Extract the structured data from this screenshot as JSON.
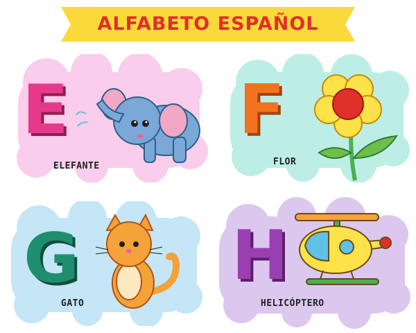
{
  "title": "ALFABETO ESPAÑOL",
  "colors": {
    "banner": "#fbd93a",
    "title_text": "#e0302a",
    "card_e": "#f9cdeb",
    "card_f": "#bdeee6",
    "card_g": "#c4e6f6",
    "card_h": "#dcc8ee"
  },
  "cards": [
    {
      "letter": "E",
      "word": "ELEFANTE",
      "letter_color": "#e6398c",
      "icon": "elephant-icon"
    },
    {
      "letter": "F",
      "word": "FLOR",
      "letter_color": "#f2731f",
      "icon": "flower-icon"
    },
    {
      "letter": "G",
      "word": "GATO",
      "letter_color": "#1f8e6f",
      "icon": "cat-icon"
    },
    {
      "letter": "H",
      "word": "HELICÓPTERO",
      "letter_color": "#9a3fb0",
      "icon": "helicopter-icon"
    }
  ]
}
